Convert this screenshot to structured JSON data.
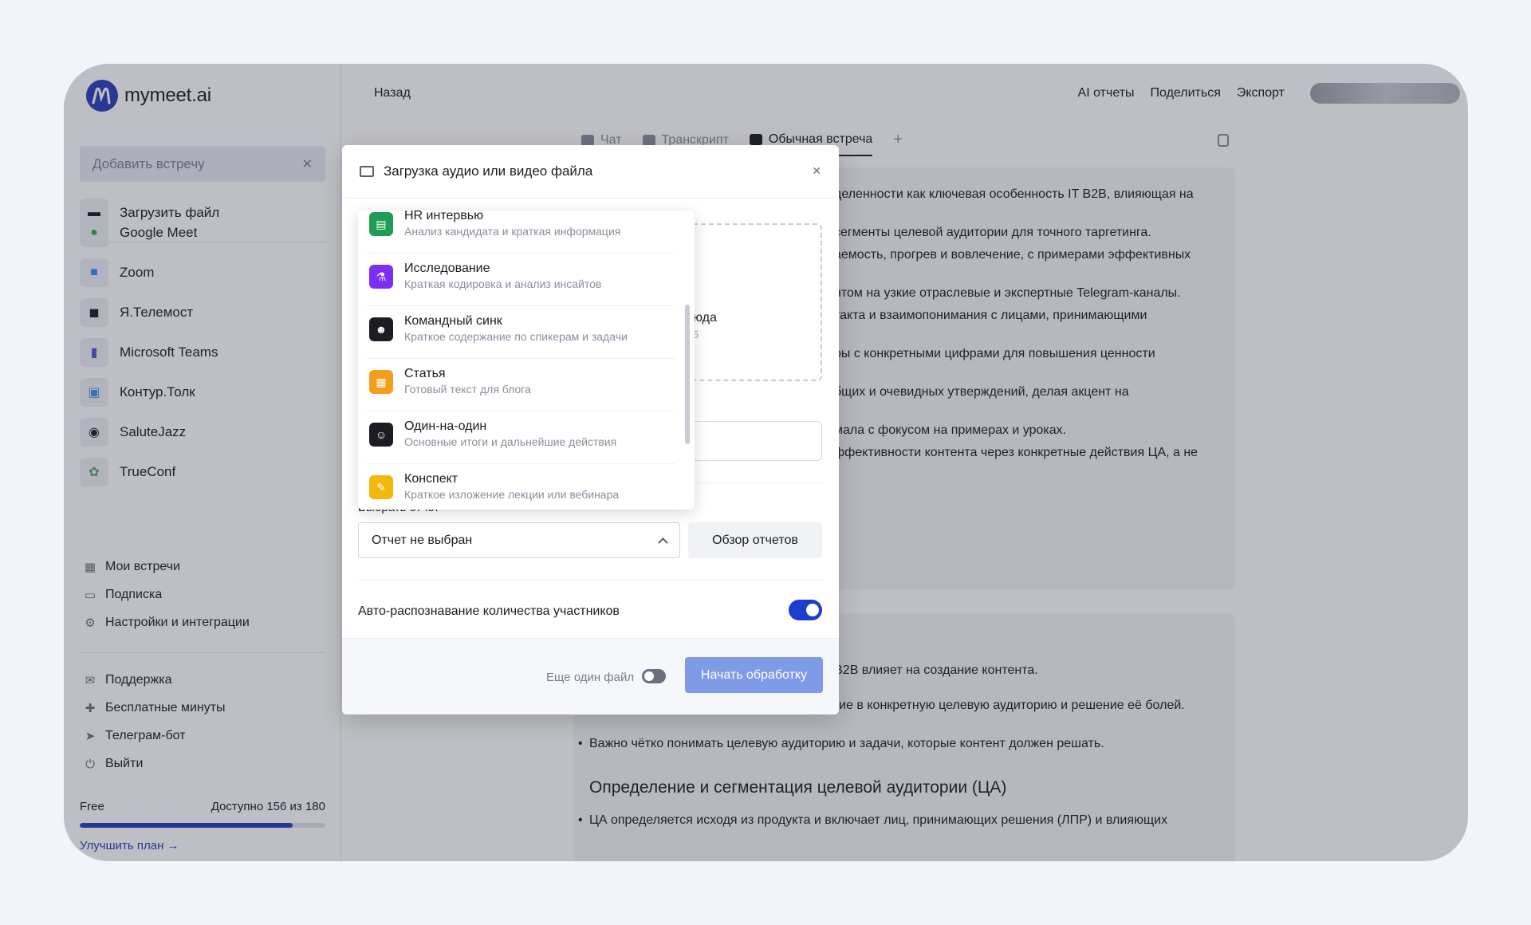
{
  "app": {
    "logo_text": "mymeet.ai"
  },
  "sidebar": {
    "add_meeting": "Добавить встречу",
    "upload_file": "Загрузить файл",
    "integrations": [
      {
        "label": "Google Meet",
        "icon": "google-meet-icon",
        "color": "#34a853"
      },
      {
        "label": "Zoom",
        "icon": "zoom-icon",
        "color": "#2d8cff"
      },
      {
        "label": "Я.Телемост",
        "icon": "telemost-icon",
        "color": "#1c1d22"
      },
      {
        "label": "Microsoft Teams",
        "icon": "teams-icon",
        "color": "#5059c9"
      },
      {
        "label": "Контур.Толк",
        "icon": "kontur-icon",
        "color": "#3f8ee8"
      },
      {
        "label": "SaluteJazz",
        "icon": "salutejazz-icon",
        "color": "#1c1d22"
      },
      {
        "label": "TrueConf",
        "icon": "trueconf-icon",
        "color": "#5aa469"
      }
    ],
    "nav": [
      {
        "label": "Мои встречи",
        "icon": "grid-icon"
      },
      {
        "label": "Подписка",
        "icon": "card-icon"
      },
      {
        "label": "Настройки и интеграции",
        "icon": "gear-icon"
      }
    ],
    "support": [
      {
        "label": "Поддержка",
        "icon": "chat-icon"
      },
      {
        "label": "Бесплатные минуты",
        "icon": "gift-icon"
      },
      {
        "label": "Телеграм-бот",
        "icon": "telegram-icon"
      },
      {
        "label": "Выйти",
        "icon": "power-icon"
      }
    ],
    "plan": {
      "name": "Free",
      "available": "Доступно 156 из 180",
      "used_fraction": 0.867,
      "upgrade": "Улучшить план →"
    }
  },
  "header": {
    "back": "Назад",
    "actions": [
      "AI отчеты",
      "Поделиться",
      "Экспорт"
    ]
  },
  "tabs": [
    {
      "label": "Чат",
      "active": false
    },
    {
      "label": "Транскрипт",
      "active": false
    },
    {
      "label": "Обычная встреча",
      "active": true
    }
  ],
  "background_text": {
    "card1": [
      "деленности как ключевая особенность IT B2B, влияющая на",
      "сегменты целевой аудитории для точного таргетинга.",
      "аемость, прогрев и вовлечение, с примерами эффективных",
      "нтом на узкие отраслевые и экспертные Telegram-каналы.",
      "такта и взаимопонимания с лицами, принимающими",
      "ры с конкретными цифрами для повышения ценности",
      "бщих и очевидных утверждений, делая акцент на",
      "мала с фокусом на примерах и уроках.",
      "ффективности контента через конкретные действия ЦА, а не"
    ],
    "card2_bullets": [
      "Высокая степень неопределённости в IT B2B влияет на создание контента.",
      "Ключевая задача — не охваты, а попадание в конкретную целевую аудиторию и решение её болей.",
      "Важно чётко понимать целевую аудиторию и задачи, которые контент должен решать."
    ],
    "card2_heading": "Определение и сегментация целевой аудитории (ЦА)",
    "card2_last": "ЦА определяется исходя из продукта и включает лиц, принимающих решения (ЛПР) и влияющих"
  },
  "modal": {
    "title": "Загрузка аудио или видео файла",
    "dropzone_text": "юда",
    "dropzone_sub": "5",
    "report_label": "Выбрать отчет",
    "report_select": "Отчет не выбран",
    "overview_button": "Обзор отчетов",
    "auto_detect": "Авто-распознавание количества участников",
    "another_file": "Еще один файл",
    "start_button": "Начать обработку",
    "templates": [
      {
        "title": "HR интервью",
        "sub": "Анализ кандидата и краткая информация",
        "icon": "id-card-icon",
        "color": "#1f9d55",
        "glyph": "▤"
      },
      {
        "title": "Исследование",
        "sub": "Краткая кодировка и анализ инсайтов",
        "icon": "flask-icon",
        "color": "#7b2ff2",
        "glyph": "⚗"
      },
      {
        "title": "Командный синк",
        "sub": "Краткое содержание по спикерам и задачи",
        "icon": "team-icon",
        "color": "#1c1d22",
        "glyph": "☻"
      },
      {
        "title": "Статья",
        "sub": "Готовый текст для блога",
        "icon": "article-icon",
        "color": "#f59e1b",
        "glyph": "▦"
      },
      {
        "title": "Один-на-один",
        "sub": "Основные итоги и дальнейшие действия",
        "icon": "pair-icon",
        "color": "#1c1d22",
        "glyph": "☺"
      },
      {
        "title": "Конспект",
        "sub": "Краткое изложение лекции или вебинара",
        "icon": "graduation-icon",
        "color": "#f2b90c",
        "glyph": "✎"
      }
    ]
  }
}
